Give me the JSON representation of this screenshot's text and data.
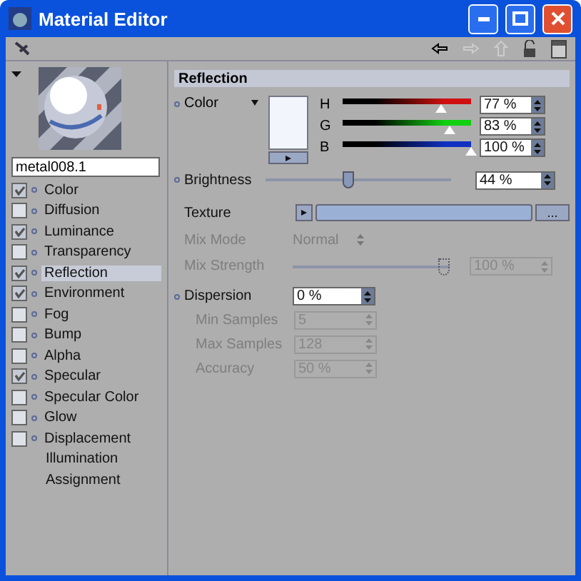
{
  "window": {
    "title": "Material Editor"
  },
  "material": {
    "name": "metal008.1"
  },
  "channels": [
    {
      "label": "Color",
      "kind": "check",
      "checked": true,
      "selected": false
    },
    {
      "label": "Diffusion",
      "kind": "check",
      "checked": false,
      "selected": false
    },
    {
      "label": "Luminance",
      "kind": "check",
      "checked": true,
      "selected": false
    },
    {
      "label": "Transparency",
      "kind": "check",
      "checked": false,
      "selected": false
    },
    {
      "label": "Reflection",
      "kind": "check",
      "checked": true,
      "selected": true
    },
    {
      "label": "Environment",
      "kind": "check",
      "checked": true,
      "selected": false
    },
    {
      "label": "Fog",
      "kind": "check",
      "checked": false,
      "selected": false
    },
    {
      "label": "Bump",
      "kind": "check",
      "checked": false,
      "selected": false
    },
    {
      "label": "Alpha",
      "kind": "check",
      "checked": false,
      "selected": false
    },
    {
      "label": "Specular",
      "kind": "check",
      "checked": true,
      "selected": false
    },
    {
      "label": "Specular Color",
      "kind": "check",
      "checked": false,
      "selected": false
    },
    {
      "label": "Glow",
      "kind": "check",
      "checked": false,
      "selected": false
    },
    {
      "label": "Displacement",
      "kind": "check",
      "checked": false,
      "selected": false
    },
    {
      "label": "Illumination",
      "kind": "plain",
      "selected": false
    },
    {
      "label": "Assignment",
      "kind": "plain",
      "selected": false
    }
  ],
  "section": {
    "title": "Reflection"
  },
  "color": {
    "label": "Color",
    "sliders": [
      {
        "label": "H",
        "level": 0.77,
        "value": "77 %",
        "color": "#d01010"
      },
      {
        "label": "G",
        "level": 0.83,
        "value": "83 %",
        "color": "#10d010"
      },
      {
        "label": "B",
        "level": 1.0,
        "value": "100 %",
        "color": "#1030c0"
      }
    ]
  },
  "brightness": {
    "label": "Brightness",
    "level": 0.44,
    "value": "44 %"
  },
  "texture": {
    "label": "Texture",
    "button": "..."
  },
  "mix_mode": {
    "label": "Mix Mode",
    "value": "Normal",
    "disabled": true
  },
  "mix_strength": {
    "label": "Mix Strength",
    "level": 1.0,
    "value": "100 %",
    "disabled": true
  },
  "dispersion": {
    "label": "Dispersion",
    "value": "0 %"
  },
  "sub_fields": [
    {
      "label": "Min Samples",
      "value": "5",
      "disabled": true
    },
    {
      "label": "Max Samples",
      "value": "128",
      "disabled": true
    },
    {
      "label": "Accuracy",
      "value": "50 %",
      "disabled": true
    }
  ]
}
